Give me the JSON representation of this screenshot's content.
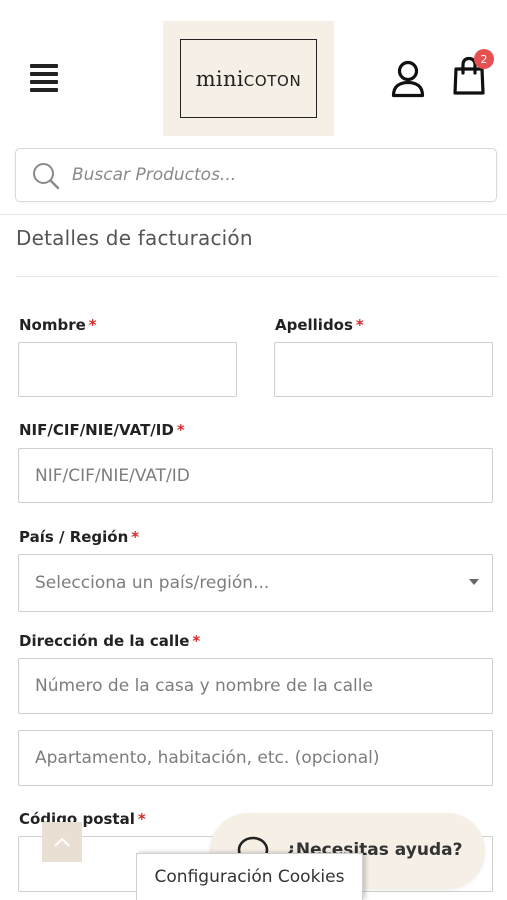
{
  "header": {
    "logo_part1": "mini",
    "logo_part2": "COTON",
    "cart_count": "2"
  },
  "search": {
    "placeholder": "Buscar Productos..."
  },
  "billing": {
    "title": "Detalles de facturación",
    "required_mark": "*",
    "fields": {
      "first_name": {
        "label": "Nombre",
        "value": ""
      },
      "last_name": {
        "label": "Apellidos",
        "value": ""
      },
      "tax_id": {
        "label": "NIF/CIF/NIE/VAT/ID",
        "placeholder": "NIF/CIF/NIE/VAT/ID"
      },
      "country": {
        "label": "País / Región",
        "selected": "Selecciona un país/región..."
      },
      "street": {
        "label": "Dirección de la calle",
        "placeholder_1": "Número de la casa y nombre de la calle",
        "placeholder_2": "Apartamento, habitación, etc. (opcional)"
      },
      "postcode": {
        "label": "Código postal"
      }
    }
  },
  "help_widget": {
    "label": "¿Necesitas ayuda?"
  },
  "cookies": {
    "label": "Configuración Cookies"
  },
  "icons": [
    "menu-icon",
    "user-icon",
    "cart-icon",
    "search-icon",
    "chevron-up-icon",
    "chat-icon"
  ],
  "colors": {
    "brand_bg": "#f6efe5",
    "required": "#d42c2c",
    "badge": "#e65050"
  }
}
